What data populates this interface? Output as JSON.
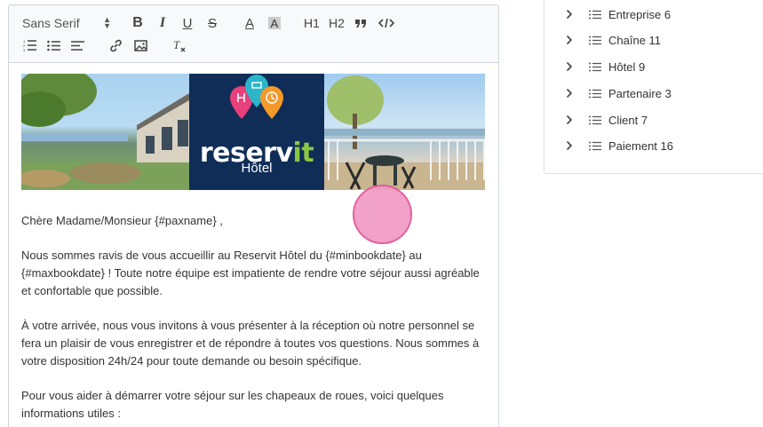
{
  "toolbar": {
    "font_family": "Sans Serif",
    "buttons": {
      "bold": "B",
      "italic": "I",
      "underline": "U",
      "strike": "S",
      "color": "A",
      "h1": "H1",
      "h2": "H2"
    }
  },
  "banner": {
    "logo_word_main": "reserv",
    "logo_word_accent": "it",
    "logo_sub": "Hôtel"
  },
  "body": {
    "p1": "Chère Madame/Monsieur {#paxname} ,",
    "p2": "Nous sommes ravis de vous accueillir au Reservit Hôtel du  {#minbookdate} au\n{#maxbookdate} ! Toute notre équipe est impatiente de rendre votre séjour aussi agréable\net confortable que possible.",
    "p3": "À votre arrivée, nous vous invitons à vous présenter à la réception où notre personnel se\nfera un plaisir de vous enregistrer et de répondre à toutes vos questions. Nous sommes à\nvotre disposition 24h/24 pour toute demande ou besoin spécifique.",
    "p4": "Pour vous aider à démarrer votre séjour sur les chapeaux de roues, voici quelques\ninformations utiles :"
  },
  "tree": {
    "items": [
      {
        "label": "Entreprise 6"
      },
      {
        "label": "Chaîne 11"
      },
      {
        "label": "Hôtel 9"
      },
      {
        "label": "Partenaire 3"
      },
      {
        "label": "Client 7"
      },
      {
        "label": "Paiement 16"
      }
    ]
  },
  "colors": {
    "logo_bg": "#0f2d57",
    "logo_accent": "#8ac645",
    "pin_pink": "#e8407b",
    "pin_teal": "#2bb5c8",
    "pin_orange": "#f39a2b",
    "cursor_dot": "#f19ac4"
  }
}
